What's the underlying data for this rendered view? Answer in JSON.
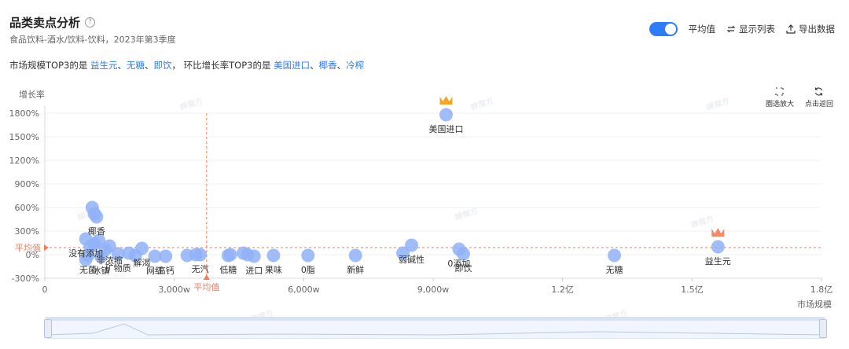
{
  "header": {
    "title": "品类卖点分析",
    "help_icon": "?",
    "subtitle": "食品饮料-酒水/饮料-饮料，2023年第3季度"
  },
  "toolbar": {
    "average_toggle_label": "平均值",
    "average_toggle_on": true,
    "show_list_label": "显示列表",
    "export_label": "导出数据"
  },
  "summary": {
    "market_prefix": "市场规模TOP3的是",
    "market_top3": [
      "益生元",
      "无糖",
      "即饮"
    ],
    "growth_prefix": "环比增长率TOP3的是",
    "growth_top3": [
      "美国进口",
      "椰香",
      "冷榨"
    ],
    "sep": "、",
    "comma": "，"
  },
  "corner_tools": {
    "zoom_label": "圈选放大",
    "reset_label": "点击返回"
  },
  "colors": {
    "accent": "#2f7cf6",
    "bubble": "#8fb1f7",
    "average_line": "#f27c5c",
    "crown": "#f5a623",
    "crown_alt": "#f08a6d"
  },
  "chart_data": {
    "type": "scatter",
    "ylabel": "增长率",
    "xlabel": "市场规模",
    "y_ticks": [
      "1800%",
      "1500%",
      "1200%",
      "900%",
      "600%",
      "300%",
      "0%",
      "-300%"
    ],
    "y_tick_values": [
      1800,
      1500,
      1200,
      900,
      600,
      300,
      0,
      -300
    ],
    "x_ticks": [
      "0",
      "3,000w",
      "6,000w",
      "9,000w",
      "1.2亿",
      "1.5亿",
      "1.8亿"
    ],
    "x_tick_values": [
      0,
      3000,
      6000,
      9000,
      12000,
      15000,
      18000
    ],
    "xlim": [
      0,
      18000
    ],
    "ylim": [
      -300,
      1800
    ],
    "average": {
      "x": 3750,
      "y": 90,
      "x_label": "平均值",
      "y_label": "平均值"
    },
    "points": [
      {
        "x": 15600,
        "y": 100,
        "label": "益生元",
        "crown": true
      },
      {
        "x": 9300,
        "y": 1780,
        "label": "美国进口",
        "crown": true
      },
      {
        "x": 13200,
        "y": -10,
        "label": "无糖"
      },
      {
        "x": 9700,
        "y": 10,
        "label": "即饮"
      },
      {
        "x": 9600,
        "y": 70,
        "label": "0添加"
      },
      {
        "x": 8500,
        "y": 120,
        "label": "弱碱性"
      },
      {
        "x": 8300,
        "y": 20,
        "label": ""
      },
      {
        "x": 7200,
        "y": -10,
        "label": "新鲜"
      },
      {
        "x": 6100,
        "y": -10,
        "label": "0脂"
      },
      {
        "x": 5300,
        "y": -10,
        "label": "果味"
      },
      {
        "x": 4850,
        "y": -20,
        "label": "进口"
      },
      {
        "x": 4700,
        "y": 0,
        "label": ""
      },
      {
        "x": 4600,
        "y": 20,
        "label": ""
      },
      {
        "x": 4300,
        "y": 0,
        "label": ""
      },
      {
        "x": 4250,
        "y": -10,
        "label": "低糖"
      },
      {
        "x": 3600,
        "y": 0,
        "label": "无汽"
      },
      {
        "x": 3500,
        "y": 0,
        "label": ""
      },
      {
        "x": 3300,
        "y": -10,
        "label": ""
      },
      {
        "x": 2800,
        "y": -20,
        "label": "高钙"
      },
      {
        "x": 2550,
        "y": -20,
        "label": "网红"
      },
      {
        "x": 2250,
        "y": 80,
        "label": "解渴"
      },
      {
        "x": 2100,
        "y": -10,
        "label": ""
      },
      {
        "x": 1950,
        "y": 20,
        "label": ""
      },
      {
        "x": 1700,
        "y": 10,
        "label": "矿物质"
      },
      {
        "x": 1500,
        "y": 110,
        "label": "非浓缩"
      },
      {
        "x": 1250,
        "y": 180,
        "label": ""
      },
      {
        "x": 1400,
        "y": 60,
        "label": ""
      },
      {
        "x": 1300,
        "y": -20,
        "label": "冰镇"
      },
      {
        "x": 1200,
        "y": 480,
        "label": "椰香"
      },
      {
        "x": 1150,
        "y": 520,
        "label": ""
      },
      {
        "x": 1100,
        "y": 600,
        "label": ""
      },
      {
        "x": 1150,
        "y": 140,
        "label": ""
      },
      {
        "x": 1050,
        "y": 100,
        "label": ""
      },
      {
        "x": 950,
        "y": 200,
        "label": "没有添加"
      },
      {
        "x": 1000,
        "y": -10,
        "label": "无菌"
      },
      {
        "x": 950,
        "y": -60,
        "label": ""
      }
    ]
  },
  "watermark": "蝉魔方"
}
